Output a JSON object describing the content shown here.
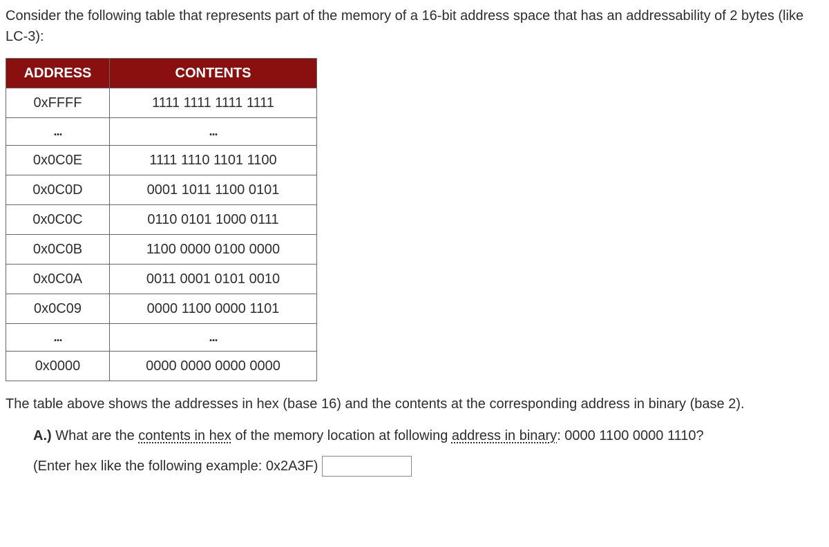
{
  "intro": "Consider the following table that represents part of the memory of a 16-bit address space that has an addressability of 2 bytes (like LC-3):",
  "table": {
    "headers": {
      "address": "ADDRESS",
      "contents": "CONTENTS"
    },
    "rows": [
      {
        "address": "0xFFFF",
        "contents": "1111 1111 1111 1111"
      },
      {
        "address": "...",
        "contents": "..."
      },
      {
        "address": "0x0C0E",
        "contents": "1111 1110 1101 1100"
      },
      {
        "address": "0x0C0D",
        "contents": "0001 1011 1100 0101"
      },
      {
        "address": "0x0C0C",
        "contents": "0110 0101 1000 0111"
      },
      {
        "address": "0x0C0B",
        "contents": "1100 0000 0100 0000"
      },
      {
        "address": "0x0C0A",
        "contents": "0011 0001 0101 0010"
      },
      {
        "address": "0x0C09",
        "contents": "0000 1100 0000 1101"
      },
      {
        "address": "...",
        "contents": "..."
      },
      {
        "address": "0x0000",
        "contents": "0000 0000 0000 0000"
      }
    ]
  },
  "below": "The table above shows the addresses in hex (base 16) and the contents at the corresponding address in binary (base 2).",
  "question": {
    "label": "A.)",
    "pre": " What are the ",
    "u1": "contents in hex",
    "mid": " of the memory location at following ",
    "u2": "address in binary",
    "post": ": 0000 1100 0000 1110?"
  },
  "input_hint": "(Enter hex like the following example: 0x2A3F)",
  "answer_value": ""
}
